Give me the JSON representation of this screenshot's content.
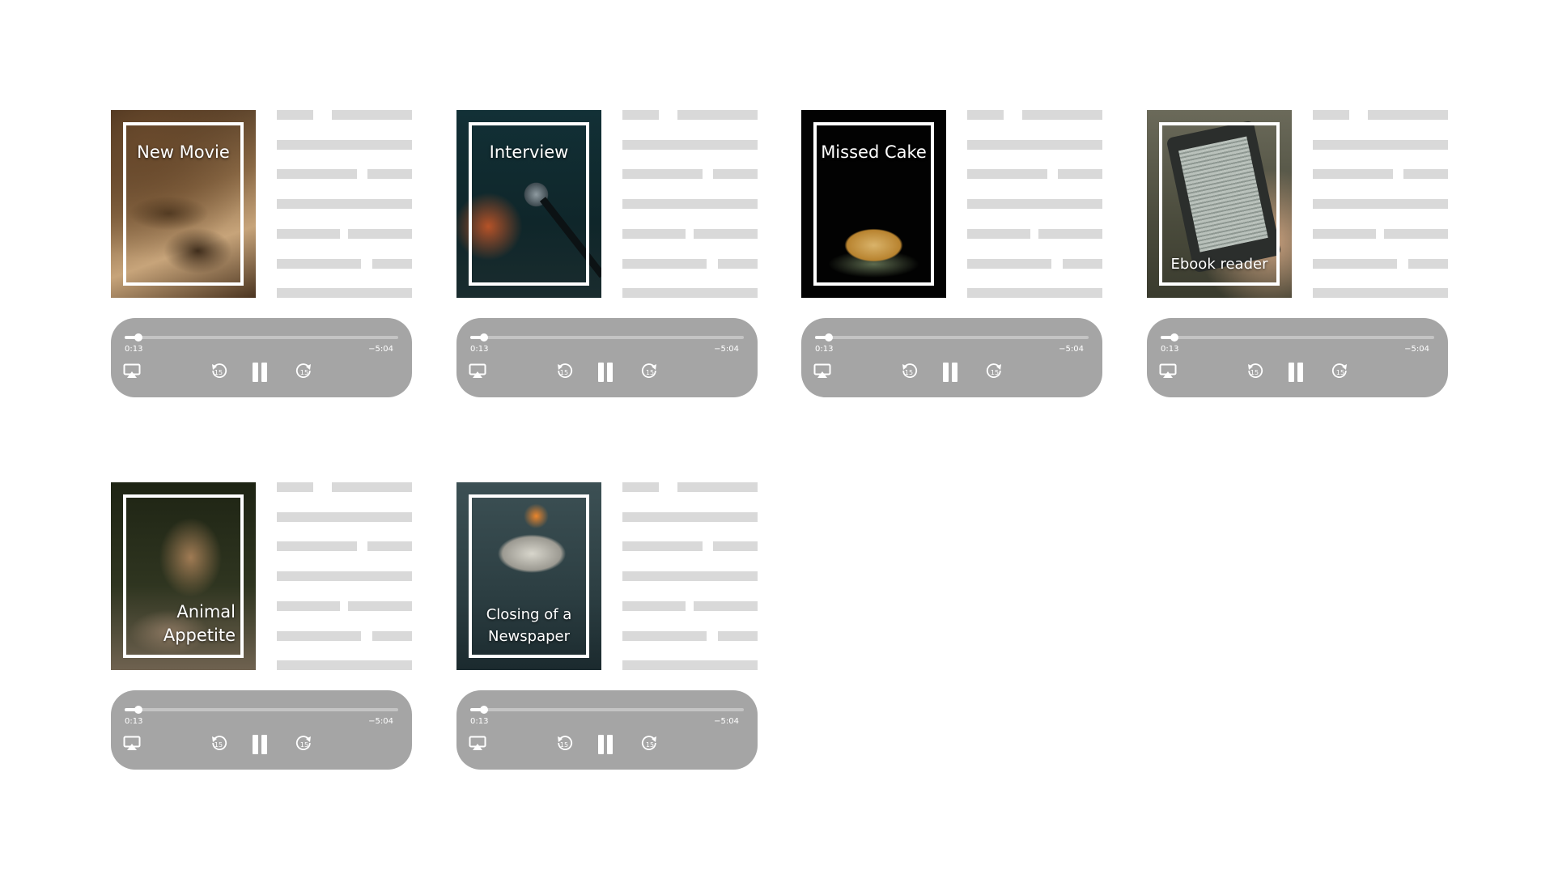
{
  "cards": [
    {
      "title": "New Movie",
      "elapsed": "0:13",
      "remaining": "−5:04",
      "progress": 0.05
    },
    {
      "title": "Interview",
      "elapsed": "0:13",
      "remaining": "−5:04",
      "progress": 0.05
    },
    {
      "title": "Missed Cake",
      "elapsed": "0:13",
      "remaining": "−5:04",
      "progress": 0.05
    },
    {
      "title": "Ebook reader",
      "elapsed": "0:13",
      "remaining": "−5:04",
      "progress": 0.05
    },
    {
      "title": "Animal Appetite",
      "elapsed": "0:13",
      "remaining": "−5:04",
      "progress": 0.05
    },
    {
      "title": "Closing of a Newspaper",
      "elapsed": "0:13",
      "remaining": "−5:04",
      "progress": 0.05
    }
  ],
  "player_controls": {
    "airplay_icon": "airplay-icon",
    "skip_back_icon": "skip-back-15-icon",
    "skip_back_seconds": "15",
    "pause_icon": "pause-icon",
    "skip_forward_icon": "skip-forward-15-icon",
    "skip_forward_seconds": "15"
  },
  "colors": {
    "player_background": "#a5a5a5",
    "placeholder_line": "#d9d9d9",
    "frame": "#ffffff"
  }
}
